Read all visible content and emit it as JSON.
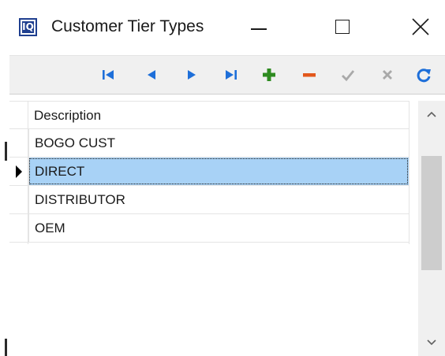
{
  "window": {
    "title": "Customer Tier Types",
    "app_icon_text": "IQ",
    "controls": [
      "minimize-icon",
      "maximize-icon",
      "close-icon"
    ]
  },
  "toolbar": {
    "buttons": [
      {
        "name": "first-record",
        "icon": "first-record-icon",
        "color": "#1e6fd9"
      },
      {
        "name": "prior-record",
        "icon": "prior-record-icon",
        "color": "#1e6fd9"
      },
      {
        "name": "next-record",
        "icon": "next-record-icon",
        "color": "#1e6fd9"
      },
      {
        "name": "last-record",
        "icon": "last-record-icon",
        "color": "#1e6fd9"
      },
      {
        "name": "insert-record",
        "icon": "plus-icon",
        "color": "#2e8b20"
      },
      {
        "name": "delete-record",
        "icon": "minus-icon",
        "color": "#e2571b"
      },
      {
        "name": "post-edit",
        "icon": "check-icon",
        "color": "#a9a9a9"
      },
      {
        "name": "cancel-edit",
        "icon": "x-icon",
        "color": "#a9a9a9"
      },
      {
        "name": "refresh",
        "icon": "refresh-icon",
        "color": "#1e6fd9"
      }
    ]
  },
  "grid": {
    "columns": [
      {
        "label": "Description"
      }
    ],
    "rows": [
      {
        "description": "BOGO CUST",
        "selected": false
      },
      {
        "description": "DIRECT",
        "selected": true
      },
      {
        "description": "DISTRIBUTOR",
        "selected": false
      },
      {
        "description": "OEM",
        "selected": false
      }
    ],
    "selection_color": "#a8d2f6"
  },
  "scrollbar": {
    "icons": [
      "chevron-up-icon",
      "chevron-down-icon"
    ]
  }
}
